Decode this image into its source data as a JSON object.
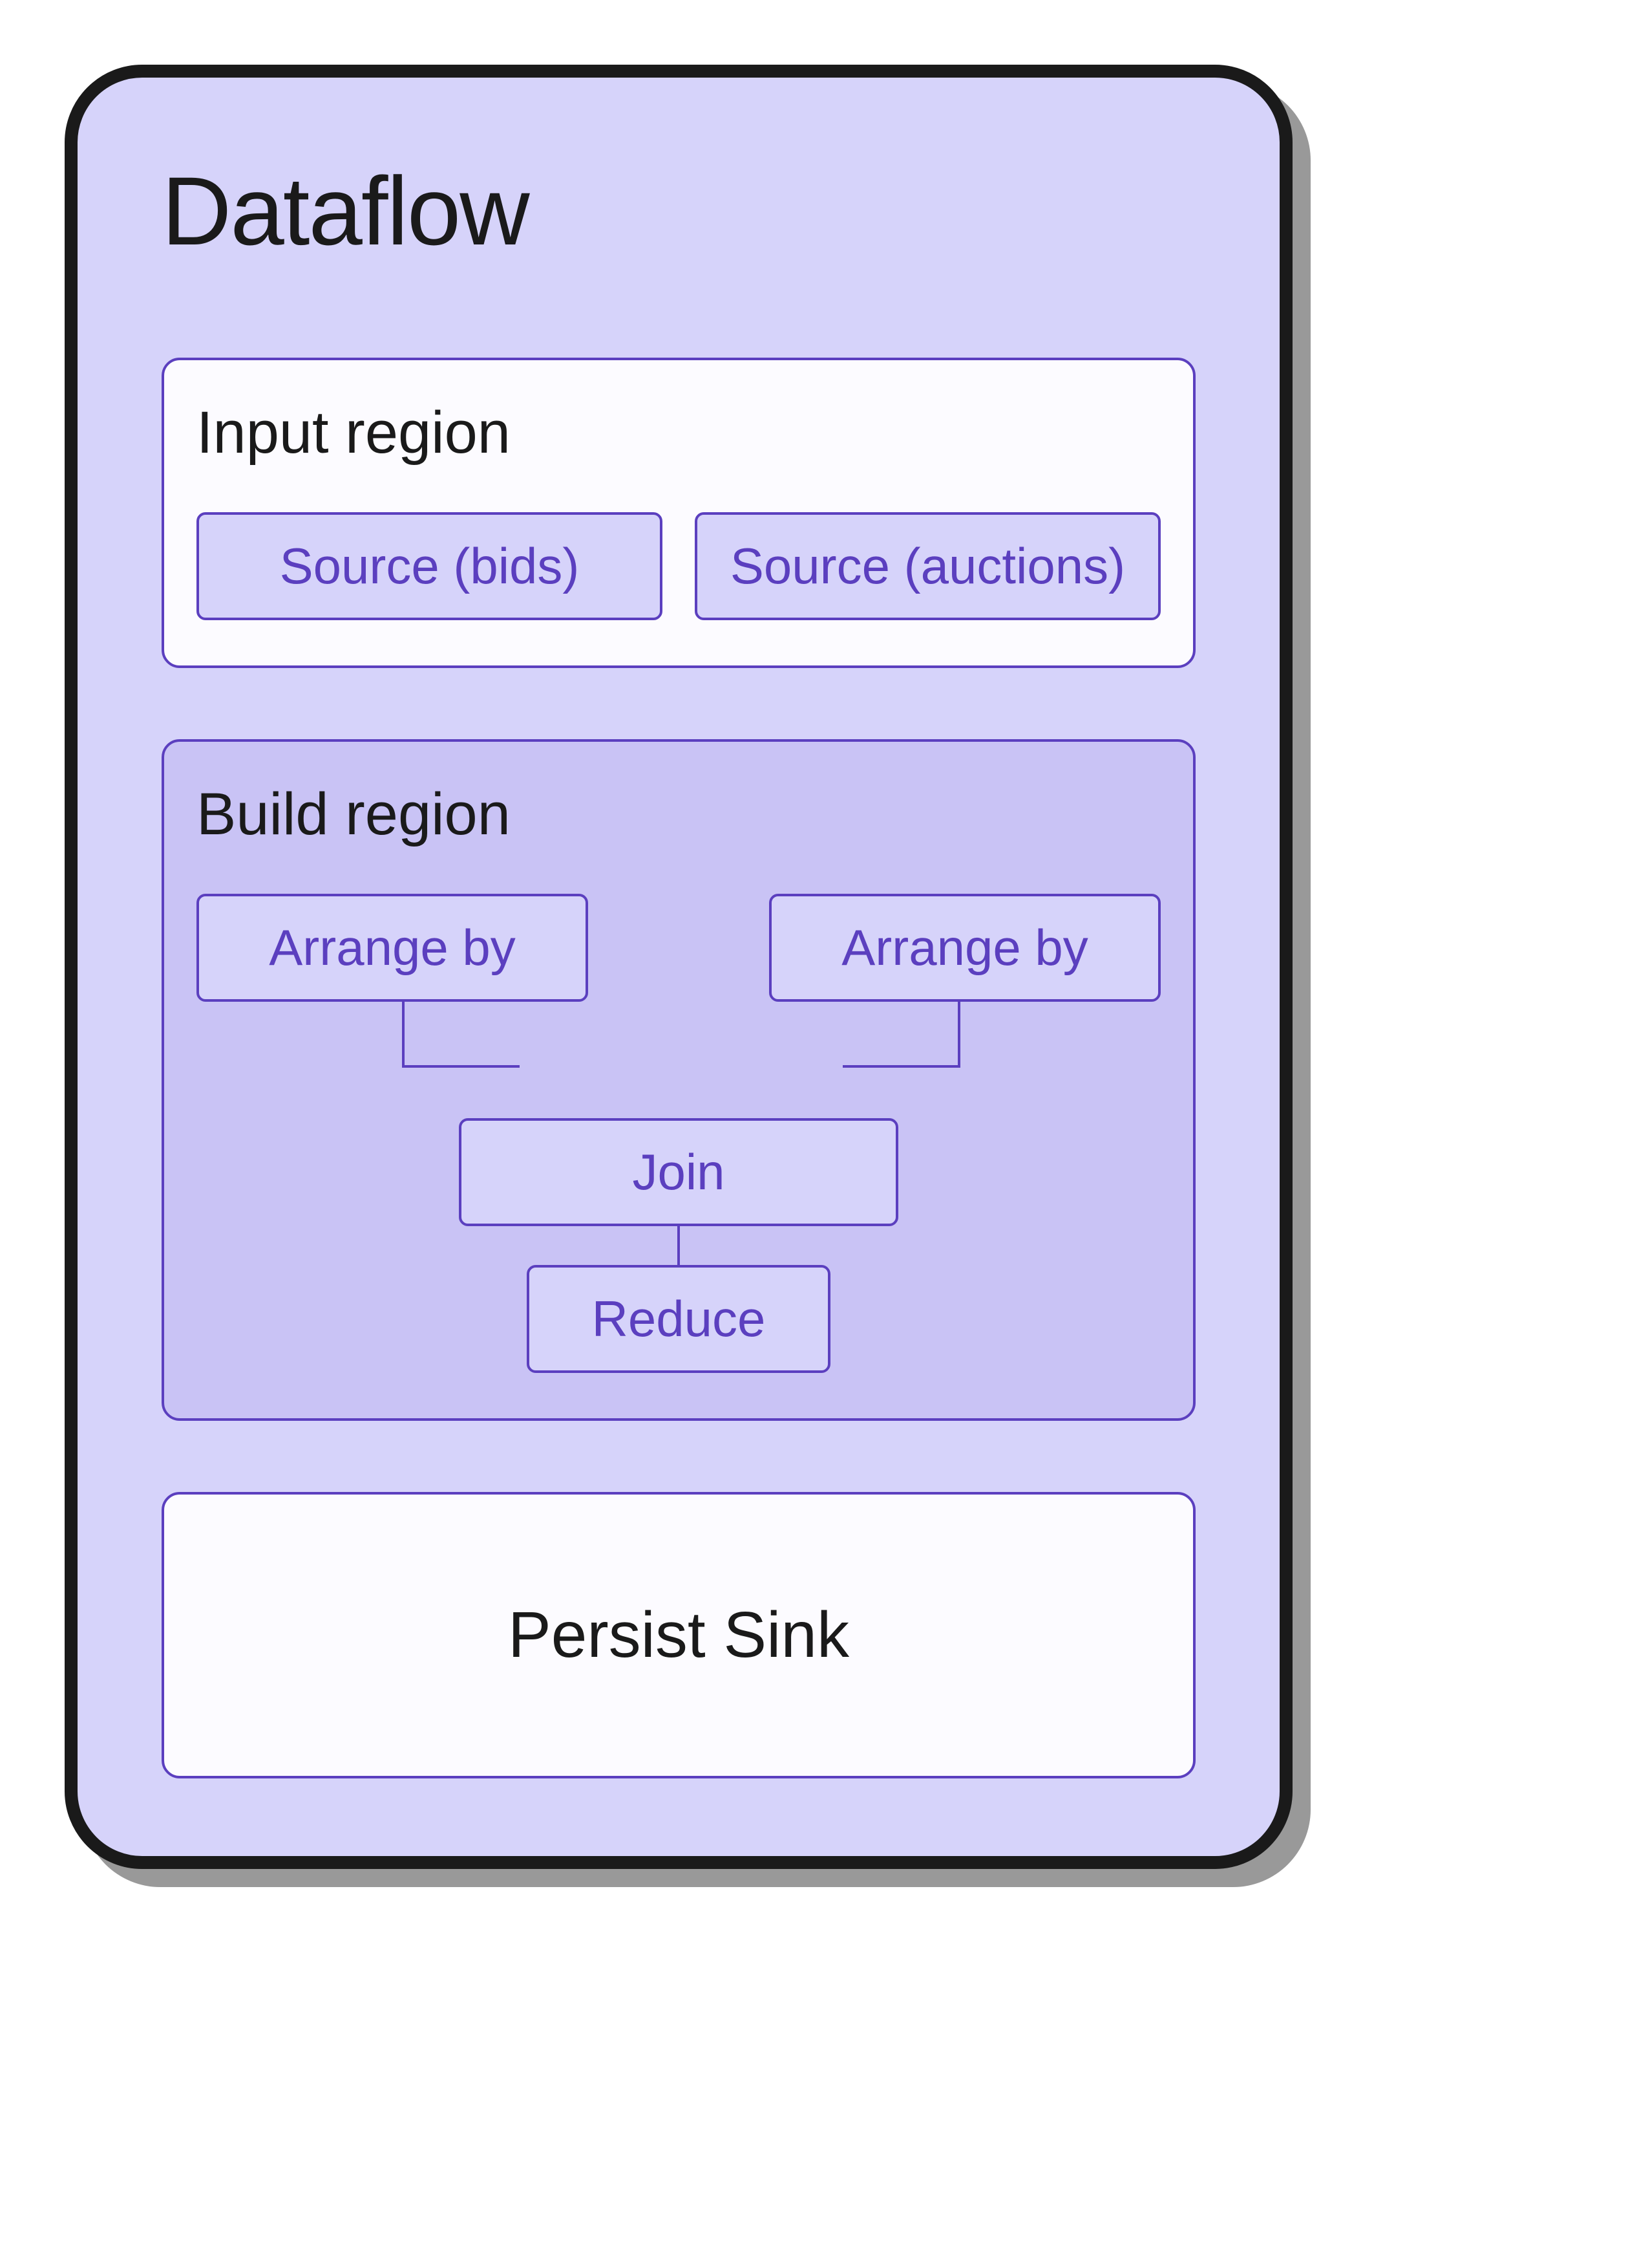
{
  "title": "Dataflow",
  "input_region": {
    "title": "Input region",
    "sources": [
      {
        "label": "Source (bids)"
      },
      {
        "label": "Source (auctions)"
      }
    ]
  },
  "build_region": {
    "title": "Build region",
    "arrange_left": "Arrange by",
    "arrange_right": "Arrange by",
    "join": "Join",
    "reduce": "Reduce"
  },
  "sink": {
    "title": "Persist Sink"
  }
}
